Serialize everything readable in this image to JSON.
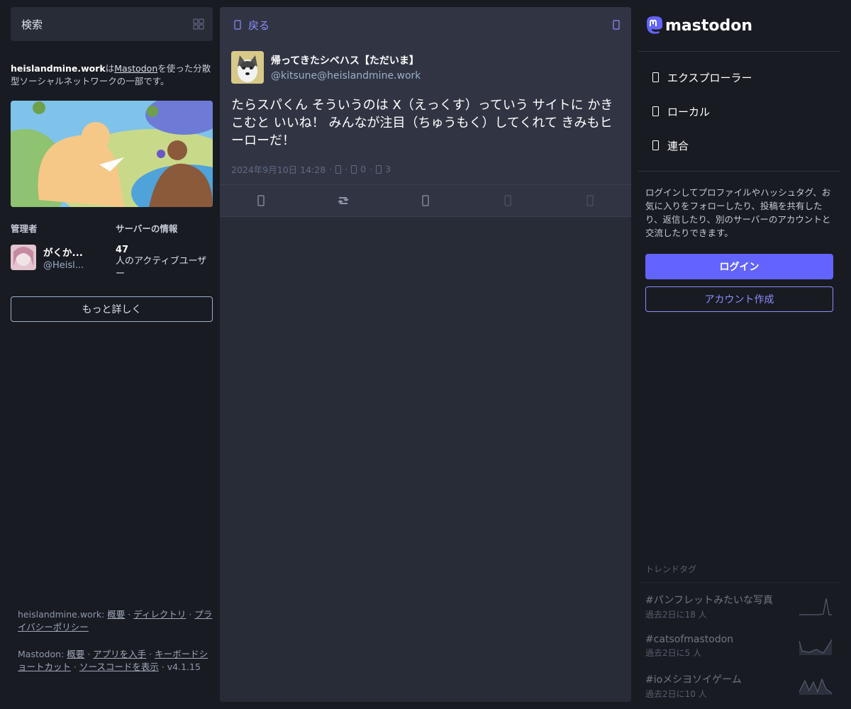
{
  "search": {
    "placeholder": "検索"
  },
  "about": {
    "server": "heislandmine.work",
    "text_ha": "は",
    "mastodon_link": "Mastodon",
    "text_rest": "を使った分散型ソーシャルネットワークの一部です。"
  },
  "info": {
    "admin_heading": "管理者",
    "admin_name": "がくか...",
    "admin_acct": "@Heisl...",
    "server_heading": "サーバーの情報",
    "active_count": "47",
    "active_label": "人のアクティブユーザー"
  },
  "more_button": "もっと詳しく",
  "footer": {
    "server_label": "heislandmine.work:",
    "links_server": [
      "概要",
      "ディレクトリ",
      "プライバシーポリシー"
    ],
    "mastodon_label": "Mastodon:",
    "links_mastodon": [
      "概要",
      "アプリを入手",
      "キーボードショートカット",
      "ソースコードを表示"
    ],
    "version": "v4.1.15"
  },
  "column": {
    "back_label": "戻る"
  },
  "status": {
    "display_name": "帰ってきたシベハス【ただいま】",
    "acct": "@kitsune@heislandmine.work",
    "content": "たらスパくん そういうのは X（えっくす）っていう サイトに かきこむと いいね！ みんなが注目（ちゅうもく）してくれて きみもヒーローだ！",
    "timestamp": "2024年9月10日 14:28",
    "boosts": "0",
    "favourites": "3"
  },
  "brand": {
    "name": "mastodon",
    "accent": "#6364ff"
  },
  "nav": [
    {
      "label": "エクスプローラー",
      "icon": "hashtag-icon"
    },
    {
      "label": "ローカル",
      "icon": "users-icon"
    },
    {
      "label": "連合",
      "icon": "globe-icon"
    }
  ],
  "signup": {
    "text": "ログインしてプロファイルやハッシュタグ、お気に入りをフォローしたり、投稿を共有したり、返信したり、別のサーバーのアカウントと交流したりできます。",
    "login": "ログイン",
    "create": "アカウント作成"
  },
  "trends": {
    "title": "トレンドタグ",
    "items": [
      {
        "tag": "#パンフレットみたいな写真",
        "uses": "過去2日に18 人"
      },
      {
        "tag": "#catsofmastodon",
        "uses": "過去2日に5 人"
      },
      {
        "tag": "#ioメシヨソイゲーム",
        "uses": "過去2日に10 人"
      }
    ]
  }
}
